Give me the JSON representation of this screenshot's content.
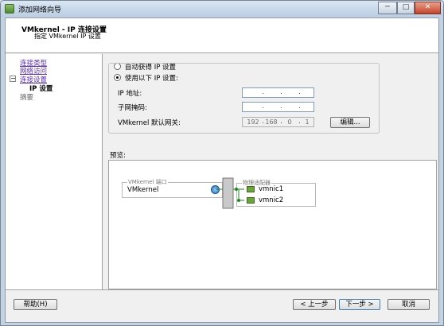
{
  "window": {
    "title": "添加网络向导",
    "minimize": "─",
    "maximize": "□",
    "close": "✕"
  },
  "header": {
    "title": "VMkernel - IP 连接设置",
    "subtitle": "指定 VMkernel IP 设置"
  },
  "nav": {
    "items": [
      {
        "label": "连接类型"
      },
      {
        "label": "网络访问"
      },
      {
        "label": "连接设置"
      },
      {
        "label": "IP 设置"
      },
      {
        "label": "摘要"
      }
    ],
    "tree_toggle": "−"
  },
  "ip": {
    "auto_label": "自动获得 IP 设置",
    "manual_label": "使用以下 IP 设置:",
    "ip_label": "IP 地址:",
    "mask_label": "子网掩码:",
    "gateway_label": "VMkernel 默认网关:",
    "gateway_octets": [
      "192",
      "168",
      "0",
      "1"
    ],
    "dot": ".",
    "edit_label": "编辑..."
  },
  "preview": {
    "label": "预览:",
    "port_group_label": "VMkernel 端口",
    "port_name": "VMkernel",
    "adapters_label": "物理适配器",
    "nics": [
      "vmnic1",
      "vmnic2"
    ]
  },
  "footer": {
    "help": "帮助(H)",
    "back": "< 上一步",
    "next": "下一步 >",
    "cancel": "取消"
  },
  "colors": {
    "accent": "#5a2fb0",
    "nic": "#6aa53a",
    "link": "#1b8a1b"
  }
}
